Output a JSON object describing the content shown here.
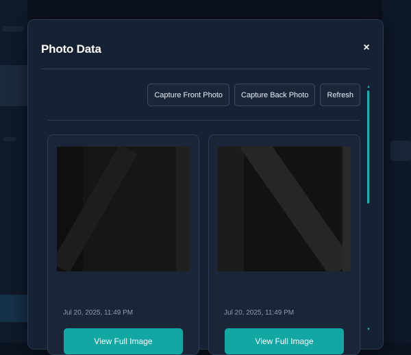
{
  "modal": {
    "title": "Photo Data",
    "close_label": "×"
  },
  "toolbar": {
    "capture_front_label": "Capture Front Photo",
    "capture_back_label": "Capture Back Photo",
    "refresh_label": "Refresh"
  },
  "photos": [
    {
      "timestamp": "Jul 20, 2025, 11:49 PM",
      "button_label": "View Full Image"
    },
    {
      "timestamp": "Jul 20, 2025, 11:49 PM",
      "button_label": "View Full Image"
    }
  ],
  "colors": {
    "accent": "#13a7a3",
    "modal_bg": "#162233",
    "page_bg": "#0c1320"
  },
  "icons": {
    "close": "close-icon",
    "scroll_up": "scroll-up-arrow-icon",
    "scroll_down": "scroll-down-arrow-icon"
  }
}
